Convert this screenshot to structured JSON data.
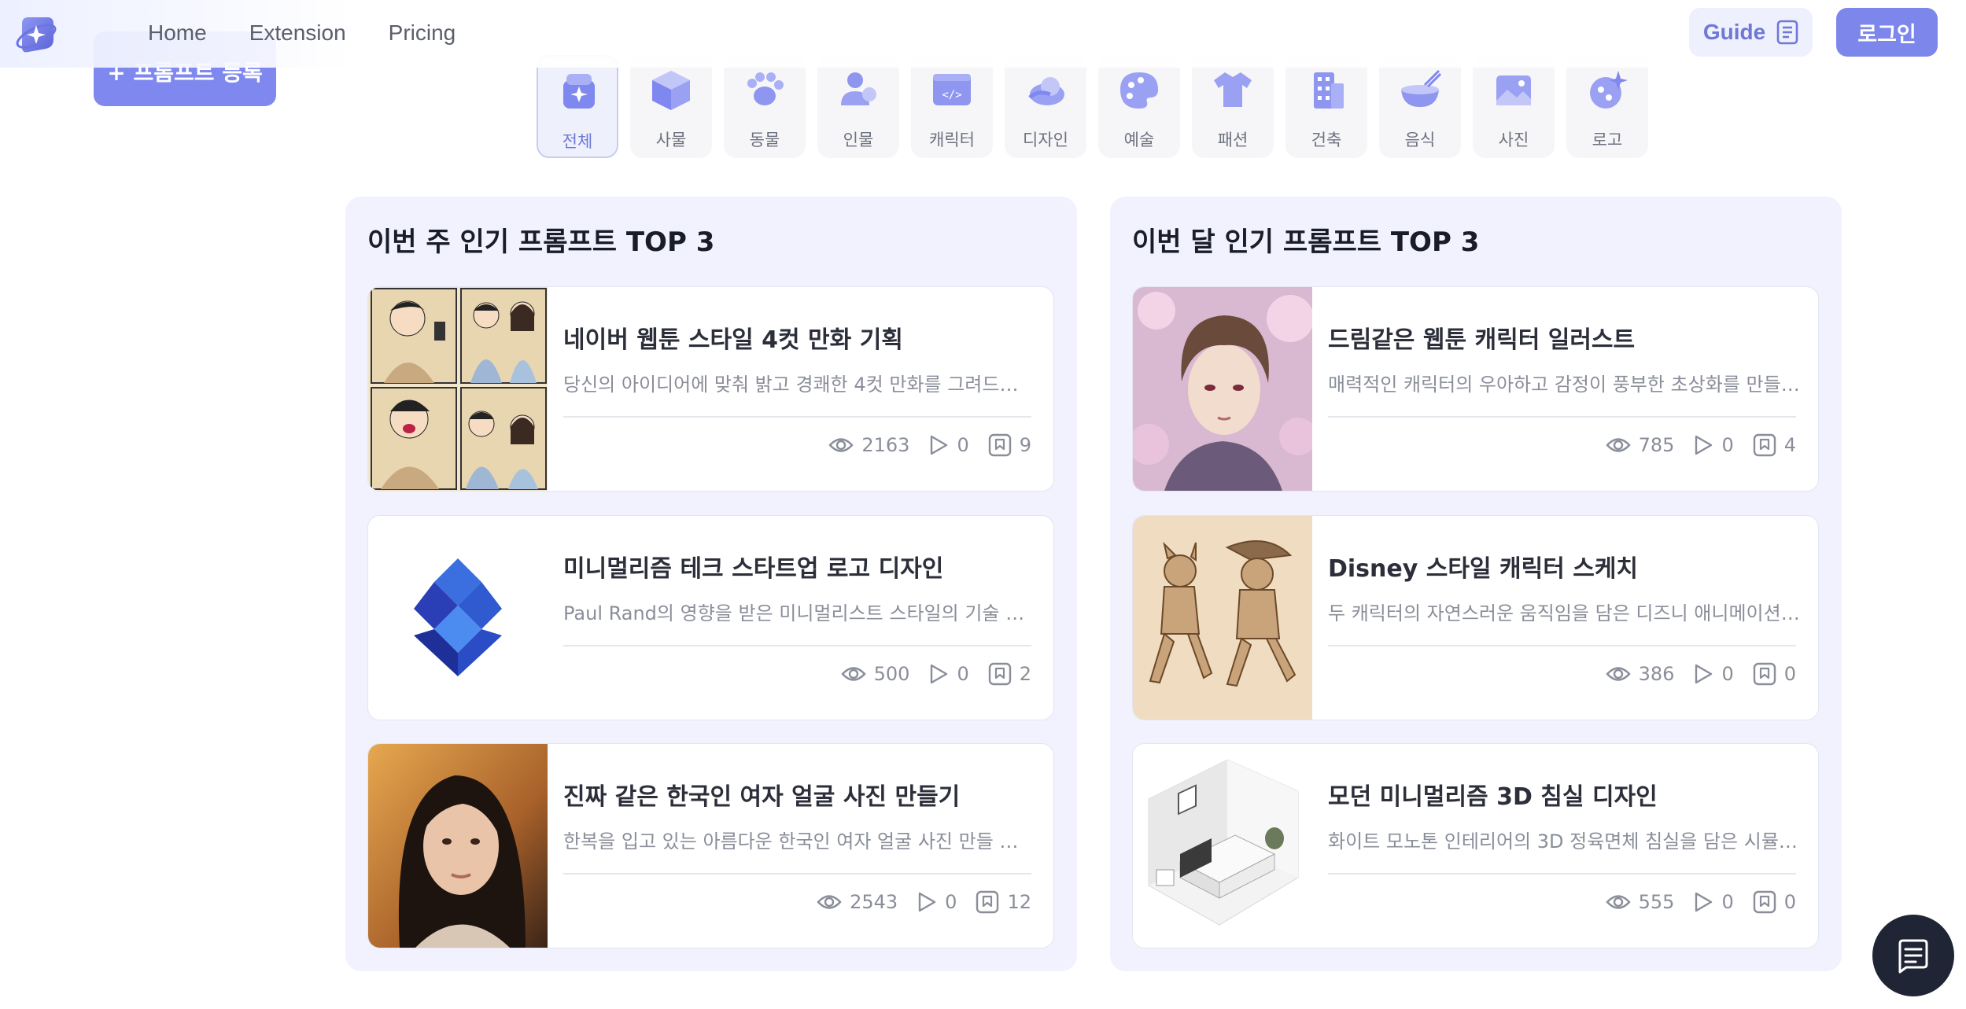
{
  "nav": {
    "links": [
      "Home",
      "Extension",
      "Pricing"
    ]
  },
  "header": {
    "guide_label": "Guide",
    "login_label": "로그인"
  },
  "register": {
    "label": "+ 프롬프트 등록"
  },
  "categories": [
    {
      "label": "전체",
      "icon": "sparkle-cube-icon"
    },
    {
      "label": "사물",
      "icon": "cube-icon"
    },
    {
      "label": "동물",
      "icon": "paw-icon"
    },
    {
      "label": "인물",
      "icon": "person-icon"
    },
    {
      "label": "캐릭터",
      "icon": "code-window-icon"
    },
    {
      "label": "디자인",
      "icon": "shape-icon"
    },
    {
      "label": "예술",
      "icon": "palette-icon"
    },
    {
      "label": "패션",
      "icon": "shirt-icon"
    },
    {
      "label": "건축",
      "icon": "building-icon"
    },
    {
      "label": "음식",
      "icon": "bowl-icon"
    },
    {
      "label": "사진",
      "icon": "photo-icon"
    },
    {
      "label": "로고",
      "icon": "logo-star-icon"
    }
  ],
  "weekly": {
    "title": "이번 주 인기 프롬프트 TOP 3",
    "items": [
      {
        "title": "네이버 웹툰 스타일 4컷 만화 기획",
        "desc": "당신의 아이디어에 맞춰 밝고 경쾌한 4컷 만화를 그려드립니다...",
        "views": "2163",
        "plays": "0",
        "saves": "9"
      },
      {
        "title": "미니멀리즘 테크 스타트업 로고 디자인",
        "desc": "Paul Rand의 영향을 받은 미니멀리스트 스타일의 기술 스타트...",
        "views": "500",
        "plays": "0",
        "saves": "2"
      },
      {
        "title": "진짜 같은 한국인 여자 얼굴 사진 만들기",
        "desc": "한복을 입고 있는 아름다운 한국인 여자 얼굴 사진 만들 수 있는...",
        "views": "2543",
        "plays": "0",
        "saves": "12"
      }
    ]
  },
  "monthly": {
    "title": "이번 달 인기 프롬프트 TOP 3",
    "items": [
      {
        "title": "드림같은 웹툰 캐릭터 일러스트",
        "desc": "매력적인 캐릭터의 우아하고 감정이 풍부한 초상화를 만들어보...",
        "views": "785",
        "plays": "0",
        "saves": "4"
      },
      {
        "title": "Disney 스타일 캐릭터 스케치",
        "desc": "두 캐릭터의 자연스러운 움직임을 담은 디즈니 애니메이션 스...",
        "views": "386",
        "plays": "0",
        "saves": "0"
      },
      {
        "title": "모던 미니멀리즘 3D 침실 디자인",
        "desc": "화이트 모노톤 인테리어의 3D 정육면체 침실을 담은 시뮬레이...",
        "views": "555",
        "plays": "0",
        "saves": "0"
      }
    ]
  },
  "colors": {
    "accent": "#7d86ea",
    "panel_bg": "#f1f2fd",
    "text_muted": "#8a8e99"
  }
}
